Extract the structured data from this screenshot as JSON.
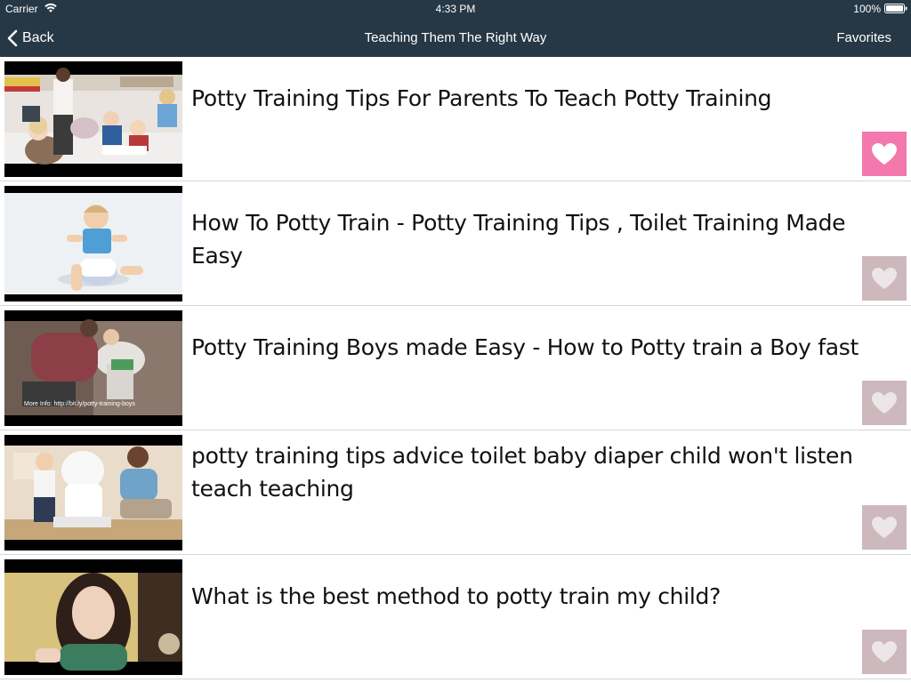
{
  "status_bar": {
    "carrier": "Carrier",
    "time": "4:33 PM",
    "battery": "100%"
  },
  "nav_bar": {
    "back_label": "Back",
    "title": "Teaching Them The Right Way",
    "favorites_label": "Favorites"
  },
  "videos": [
    {
      "title": "Potty Training Tips For Parents To Teach Potty Training",
      "favorited": true
    },
    {
      "title": "How To Potty Train - Potty Training Tips , Toilet Training Made Easy",
      "favorited": false
    },
    {
      "title": "Potty Training Boys made Easy - How to Potty train a Boy fast",
      "favorited": false,
      "thumbnail_caption": "More Info: http://bit.ly/potty-training-boys"
    },
    {
      "title": "potty training tips advice toilet baby diaper child won't listen teach teaching",
      "favorited": false
    },
    {
      "title": "What is the best method to potty train my child?",
      "favorited": false
    }
  ],
  "colors": {
    "nav_background": "#263845",
    "favorite_active": "#f378ad",
    "favorite_inactive": "#cdb8bd"
  },
  "icons": [
    "wifi-icon",
    "battery-icon",
    "back-chevron-icon",
    "heart-icon"
  ]
}
